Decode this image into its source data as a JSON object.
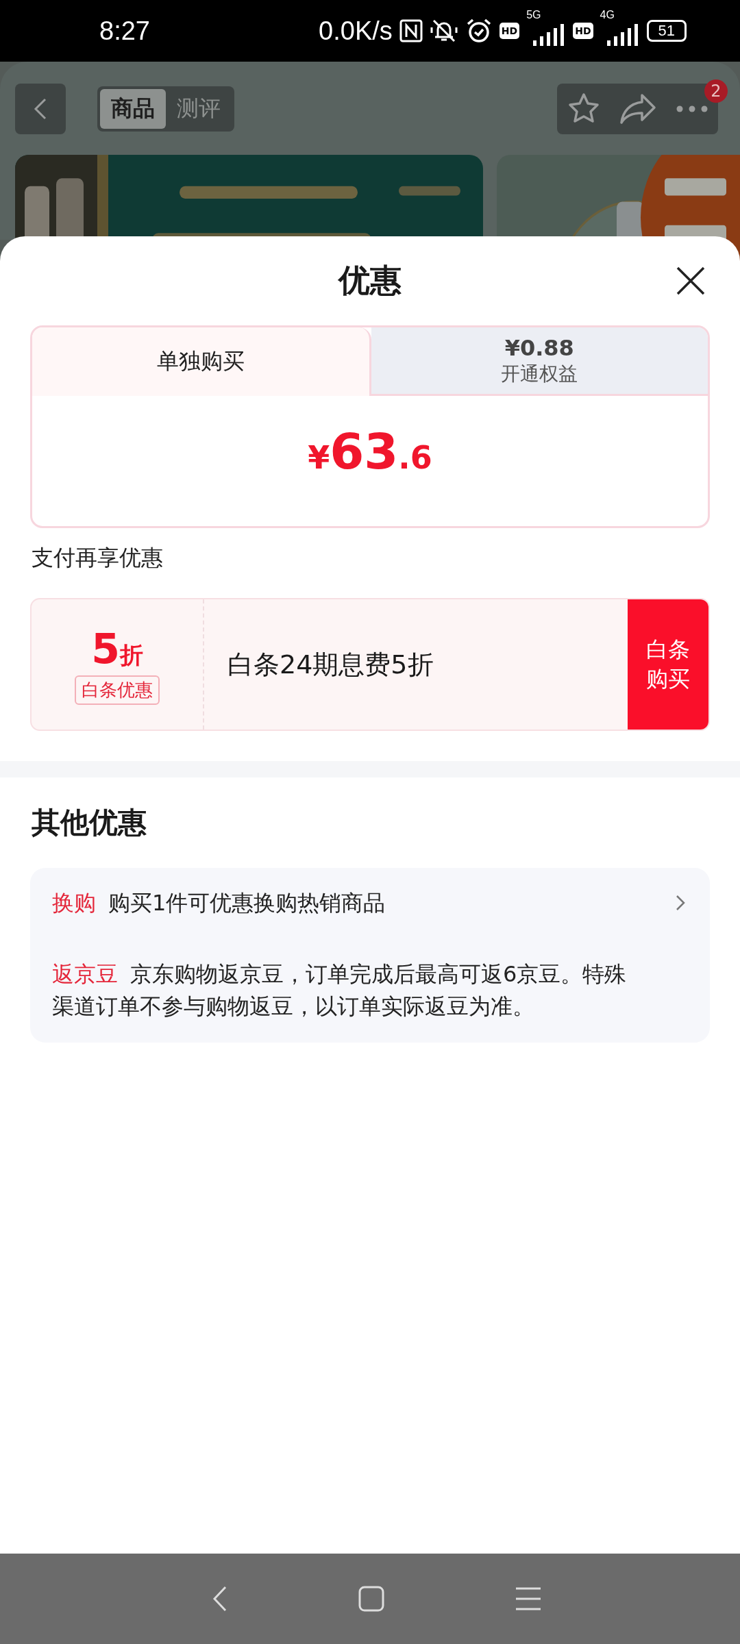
{
  "status_bar": {
    "time": "8:27",
    "speed": "0.0K/s",
    "hd_1": "HD",
    "network_1": "5G",
    "hd_2": "HD",
    "network_2": "4G",
    "battery": "51"
  },
  "header": {
    "tabs": [
      {
        "label": "商品",
        "selected": true
      },
      {
        "label": "测评",
        "selected": false
      }
    ],
    "more_badge": "2"
  },
  "sheet": {
    "title": "优惠",
    "price_tabs": [
      {
        "label": "单独购买",
        "selected": true
      },
      {
        "price": "¥0.88",
        "label": "开通权益",
        "selected": false
      }
    ],
    "price": {
      "currency": "¥",
      "integer": "63",
      "decimal": ".6"
    },
    "pay_section": {
      "title": "支付再享优惠",
      "discount_number": "5",
      "discount_unit": "折",
      "tag": "白条优惠",
      "description": "白条24期息费5折",
      "button": "白条购买"
    },
    "other_section": {
      "title": "其他优惠",
      "items": [
        {
          "tag": "换购",
          "text": "购买1件可优惠换购热销商品",
          "has_arrow": true
        },
        {
          "tag": "返京豆",
          "text": "京东购物返京豆，订单完成后最高可返6京豆。特殊渠道订单不参与购物返豆，以订单实际返豆为准。",
          "has_arrow": false
        }
      ]
    }
  }
}
